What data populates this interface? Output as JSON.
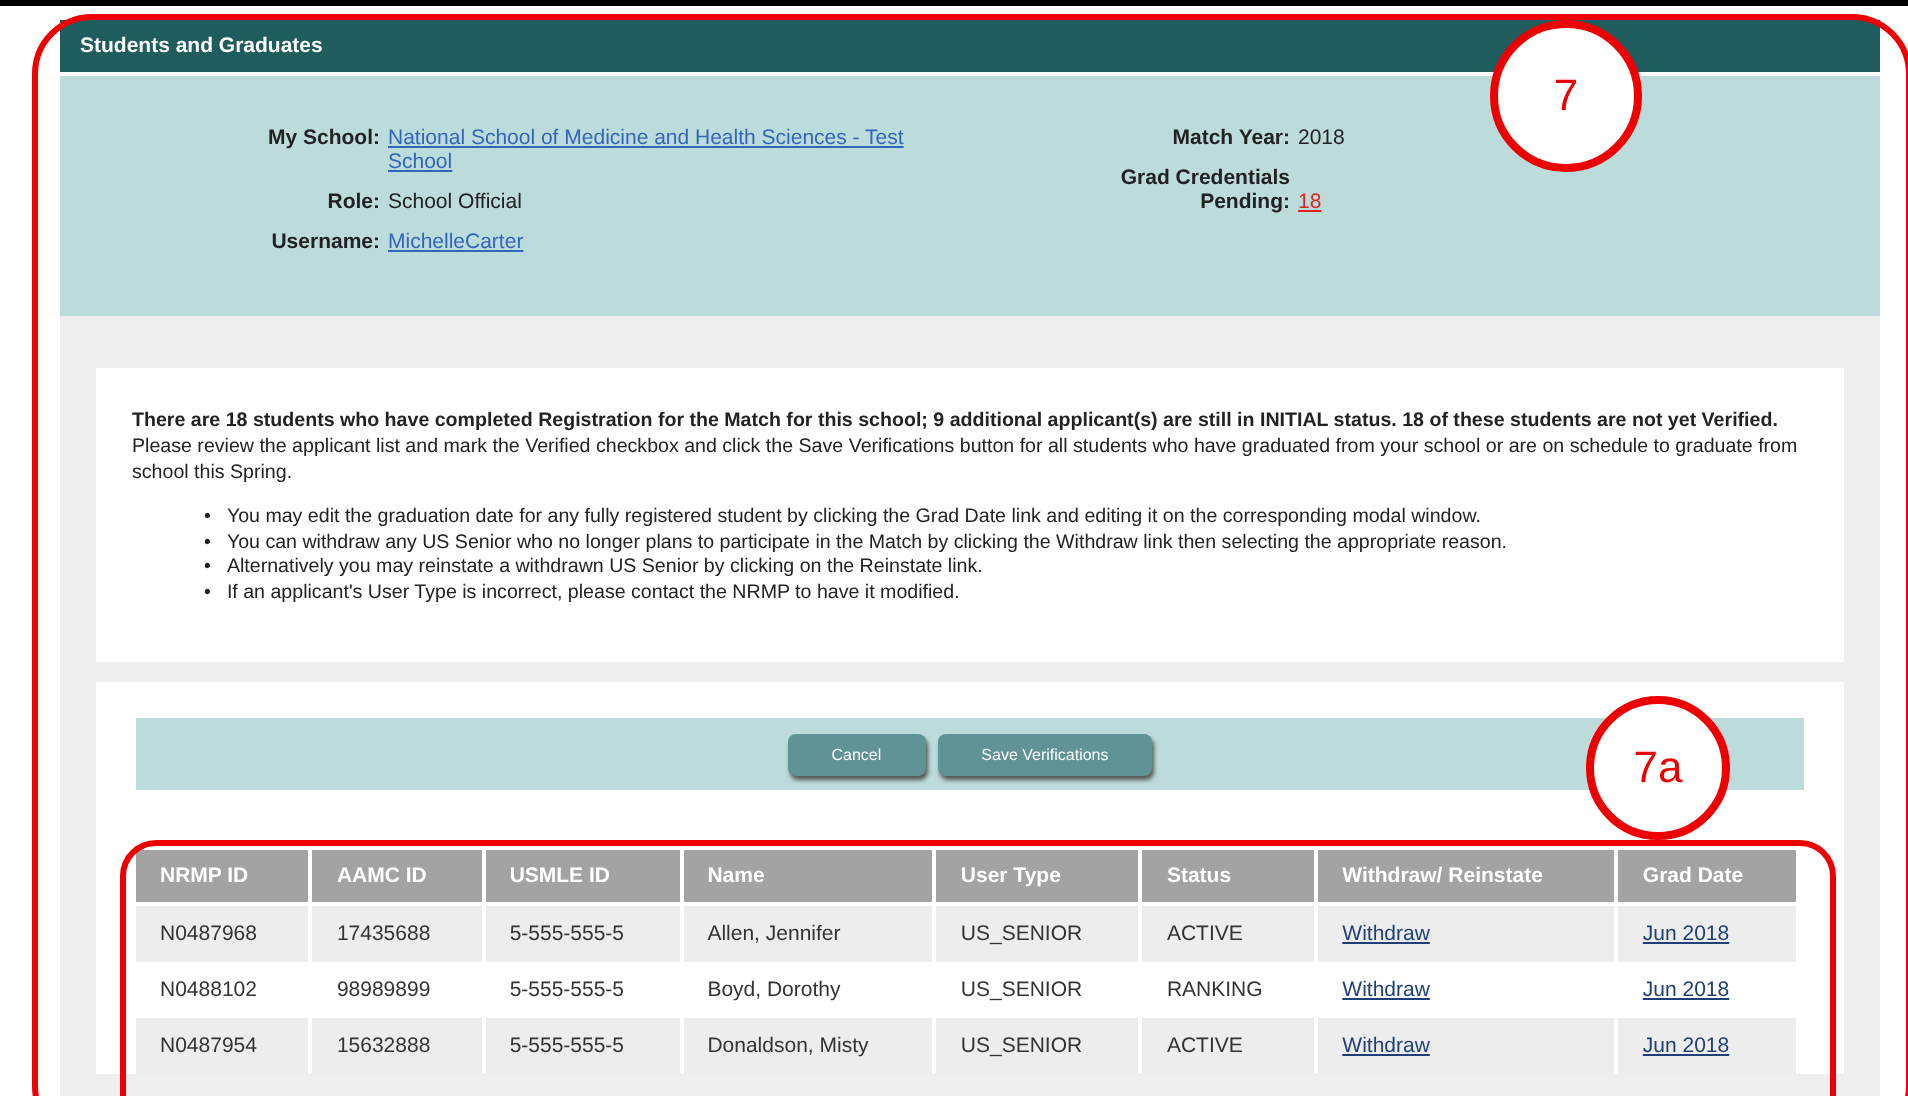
{
  "panel": {
    "title": "Students and Graduates"
  },
  "info": {
    "left": [
      {
        "label": "My School:",
        "value": "National School of Medicine and Health Sciences - Test School",
        "kind": "link"
      },
      {
        "label": "Role:",
        "value": "School Official",
        "kind": "text"
      },
      {
        "label": "Username:",
        "value": "MichelleCarter",
        "kind": "link"
      }
    ],
    "right": [
      {
        "label": "Match Year:",
        "value": "2018",
        "kind": "text"
      },
      {
        "label": "Grad Credentials Pending:",
        "value": "18",
        "kind": "alert"
      }
    ]
  },
  "notice": {
    "intro": "**There are 18 students who have completed Registration for the Match for this school; 9 additional applicant(s) are still in INITIAL status. 18 of these students are not yet Verified.** Please review the applicant list and mark the Verified checkbox and click the Save Verifications button for all students who have graduated from your school or are on schedule to graduate from school this Spring.",
    "bullets": [
      {
        "marker": "•",
        "text": "You may edit the graduation date for any fully registered student by clicking the Grad Date link and editing it on the corresponding modal window."
      },
      {
        "marker": "•",
        "text": "You can withdraw any US Senior who no longer plans to participate in the Match by clicking the Withdraw link then selecting the appropriate reason."
      },
      {
        "marker": "•",
        "text": "Alternatively you may reinstate a withdrawn US Senior by clicking on the Reinstate link."
      },
      {
        "marker": "•",
        "text": "If an applicant's User Type is incorrect, please contact the NRMP to have it modified."
      }
    ]
  },
  "buttons": [
    "Cancel",
    "Save Verifications"
  ],
  "table": {
    "columns": [
      {
        "label": "NRMP ID",
        "kind": "text"
      },
      {
        "label": "AAMC ID",
        "kind": "text"
      },
      {
        "label": "USMLE ID",
        "kind": "text"
      },
      {
        "label": "Name",
        "kind": "text"
      },
      {
        "label": "User Type",
        "kind": "text"
      },
      {
        "label": "Status",
        "kind": "text"
      },
      {
        "label": "Withdraw/ Reinstate",
        "kind": "link"
      },
      {
        "label": "Grad Date",
        "kind": "link"
      }
    ],
    "rows": [
      [
        "N0487968",
        "17435688",
        "5-555-555-5",
        "Allen, Jennifer",
        "US_SENIOR",
        "ACTIVE",
        "Withdraw",
        "Jun 2018"
      ],
      [
        "N0488102",
        "98989899",
        "5-555-555-5",
        "Boyd, Dorothy",
        "US_SENIOR",
        "RANKING",
        "Withdraw",
        "Jun 2018"
      ],
      [
        "N0487954",
        "15632888",
        "5-555-555-5",
        "Donaldson, Misty",
        "US_SENIOR",
        "ACTIVE",
        "Withdraw",
        "Jun 2018"
      ]
    ]
  },
  "callouts": [
    "7",
    "7a"
  ]
}
